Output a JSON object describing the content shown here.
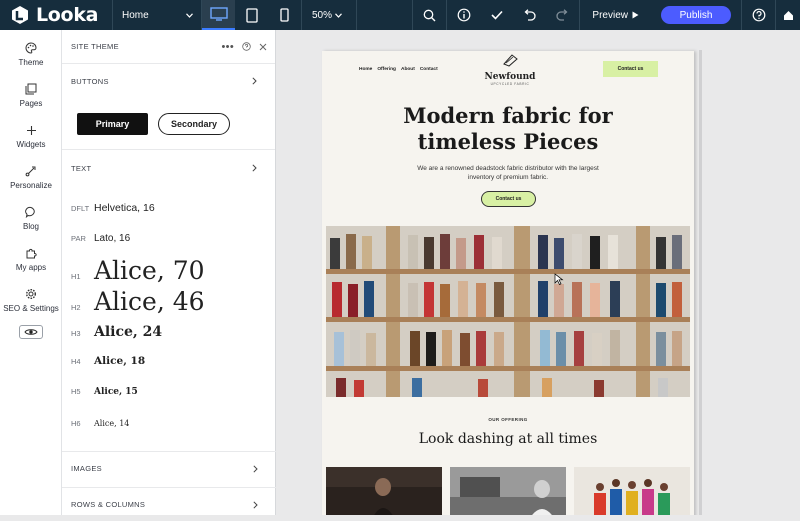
{
  "topbar": {
    "logo": "Looka",
    "page_select": "Home",
    "zoom": "50%",
    "preview_label": "Preview",
    "publish_label": "Publish",
    "accent": "#4c5cff",
    "bar_color": "#162d3d"
  },
  "sidebar": {
    "items": [
      {
        "label": "Theme",
        "icon": "palette-icon"
      },
      {
        "label": "Pages",
        "icon": "pages-icon"
      },
      {
        "label": "Widgets",
        "icon": "plus-icon"
      },
      {
        "label": "Personalize",
        "icon": "personalize-icon"
      },
      {
        "label": "Blog",
        "icon": "chat-bubble-icon"
      },
      {
        "label": "My apps",
        "icon": "puzzle-icon"
      },
      {
        "label": "SEO & Settings",
        "icon": "gear-icon"
      }
    ]
  },
  "panel": {
    "title": "SITE THEME",
    "buttons_section": "BUTTONS",
    "primary_label": "Primary",
    "secondary_label": "Secondary",
    "text_section": "TEXT",
    "styles": [
      {
        "tag": "DFLT",
        "value": "Helvetica, 16"
      },
      {
        "tag": "PAR",
        "value": "Lato, 16"
      },
      {
        "tag": "H1",
        "value": "Alice, 70"
      },
      {
        "tag": "H2",
        "value": "Alice, 46"
      },
      {
        "tag": "H3",
        "value": "Alice, 24"
      },
      {
        "tag": "H4",
        "value": "Alice, 18"
      },
      {
        "tag": "H5",
        "value": "Alice, 15"
      },
      {
        "tag": "H6",
        "value": "Alice, 14"
      }
    ],
    "images_section": "IMAGES",
    "rows_section": "ROWS & COLUMNS"
  },
  "site": {
    "nav": [
      "Home",
      "Offering",
      "About",
      "Contact"
    ],
    "brand": "Newfound",
    "brand_sub": "UPCYCLED FABRIC",
    "nav_cta": "Contact us",
    "hero_title_1": "Modern fabric for",
    "hero_title_2": "timeless Pieces",
    "hero_sub": "We are a renowned deadstock fabric distributor with the largest inventory of premium fabric.",
    "hero_cta": "Contact us",
    "offer_tag": "OUR OFFERING",
    "offer_title": "Look dashing at all times",
    "cta_color": "#d8f0a4"
  }
}
